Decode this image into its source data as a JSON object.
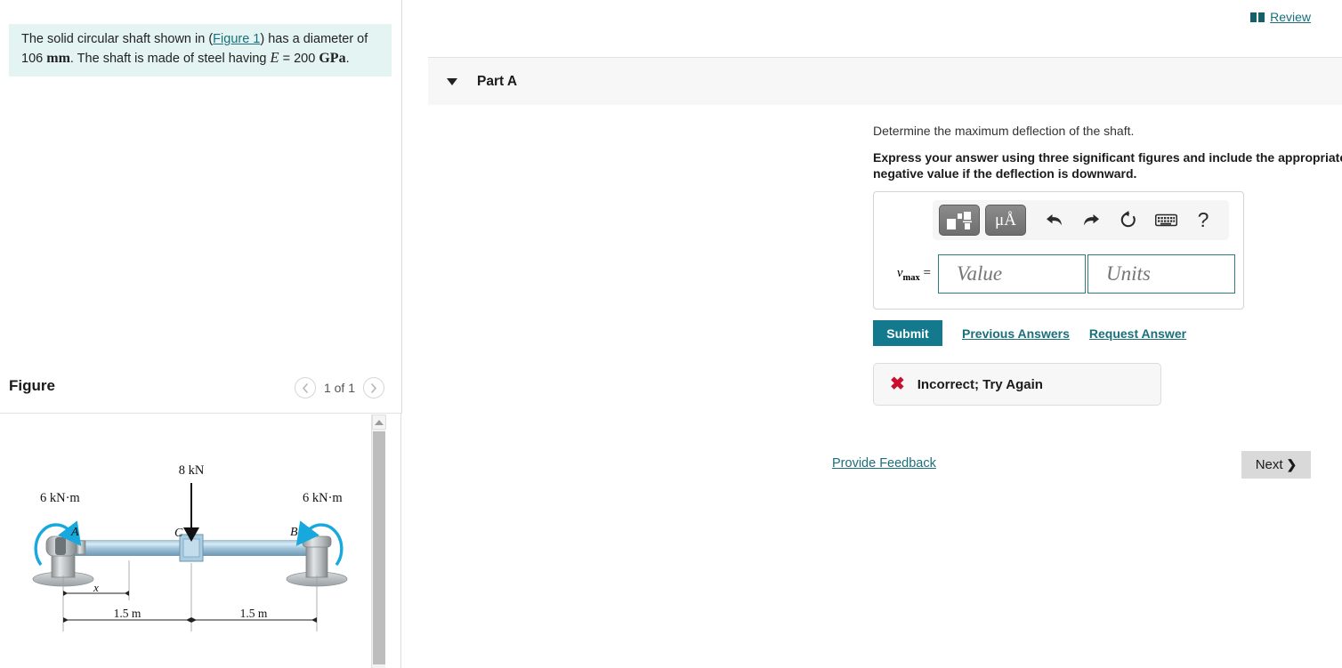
{
  "problem": {
    "text_part1": "The solid circular shaft shown in (",
    "figure_link": "Figure 1",
    "text_part2": ") has a diameter of 106 ",
    "unit_mm": "mm",
    "text_part3": ". The shaft is made of steel having ",
    "symbol_E": "E",
    "text_part4": " = 200 ",
    "unit_gpa": "GPa",
    "text_part5": "."
  },
  "figure": {
    "title": "Figure",
    "pager_label": "1 of 1",
    "prev_icon": "chevron-left-icon",
    "next_icon": "chevron-right-icon",
    "scroll_up_icon": "scroll-up-arrow-icon",
    "diagram": {
      "load_label": "8 kN",
      "moment_left": "6 kN·m",
      "moment_right": "6 kN·m",
      "point_a": "A",
      "point_b": "B",
      "point_c": "C",
      "dim_x": "x",
      "dim_left": "1.5 m",
      "dim_right": "1.5 m"
    }
  },
  "review": {
    "icon": "book-icon",
    "label": "Review"
  },
  "part": {
    "title": "Part A",
    "caret_icon": "caret-down-icon",
    "question": "Determine the maximum deflection of the shaft.",
    "instruction": "Express your answer using three significant figures and include the appropriate units. Enter positive value if the deflection is upward and negative value if the deflection is downward."
  },
  "toolbar": {
    "template_button": "template-icon",
    "units_button": "μÅ",
    "undo": "undo-icon",
    "redo": "redo-icon",
    "reset": "reset-icon",
    "keyboard": "keyboard-icon",
    "help": "?"
  },
  "answer": {
    "label_var": "v",
    "label_sub": "max",
    "label_eq": " =",
    "value_text": "",
    "value_placeholder": "Value",
    "units_text": "",
    "units_placeholder": "Units"
  },
  "actions": {
    "submit": "Submit",
    "previous_answers": "Previous Answers",
    "request_answer": "Request Answer"
  },
  "feedback": {
    "icon": "x-mark-icon",
    "message": "Incorrect; Try Again"
  },
  "footer": {
    "provide_feedback": "Provide Feedback",
    "next": "Next",
    "next_icon": "chevron-right-icon"
  },
  "colors": {
    "accent": "#1a6f7a",
    "submit": "#137a8d",
    "error": "#c8102e",
    "statement_bg": "#e4f4f3"
  }
}
